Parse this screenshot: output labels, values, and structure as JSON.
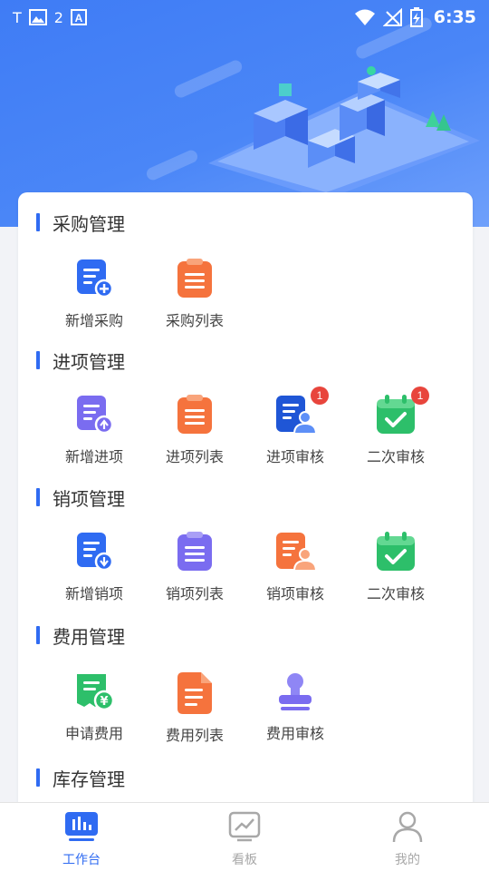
{
  "status_bar": {
    "time": "6:35",
    "left_text": "T",
    "left_num": "2",
    "icons": [
      "image-icon",
      "a-icon",
      "wifi-icon",
      "no-signal-icon",
      "battery-charging-icon"
    ]
  },
  "sections": [
    {
      "title": "采购管理",
      "items": [
        {
          "label": "新增采购",
          "icon": "doc-plus-icon",
          "badge": null
        },
        {
          "label": "采购列表",
          "icon": "clipboard-list-icon",
          "badge": null
        }
      ]
    },
    {
      "title": "进项管理",
      "items": [
        {
          "label": "新增进项",
          "icon": "doc-upload-icon",
          "badge": null
        },
        {
          "label": "进项列表",
          "icon": "clipboard-list-icon",
          "badge": null
        },
        {
          "label": "进项审核",
          "icon": "doc-user-icon",
          "badge": "1"
        },
        {
          "label": "二次审核",
          "icon": "calendar-check-icon",
          "badge": "1"
        }
      ]
    },
    {
      "title": "销项管理",
      "items": [
        {
          "label": "新增销项",
          "icon": "doc-download-icon",
          "badge": null
        },
        {
          "label": "销项列表",
          "icon": "clipboard-list-icon",
          "badge": null
        },
        {
          "label": "销项审核",
          "icon": "doc-user-icon",
          "badge": null
        },
        {
          "label": "二次审核",
          "icon": "calendar-check-icon",
          "badge": null
        }
      ]
    },
    {
      "title": "费用管理",
      "items": [
        {
          "label": "申请费用",
          "icon": "receipt-yen-icon",
          "badge": null
        },
        {
          "label": "费用列表",
          "icon": "file-list-icon",
          "badge": null
        },
        {
          "label": "费用审核",
          "icon": "stamp-icon",
          "badge": null
        }
      ]
    },
    {
      "title": "库存管理",
      "items": []
    }
  ],
  "tabs": [
    {
      "label": "工作台",
      "icon": "workbench-icon",
      "active": true
    },
    {
      "label": "看板",
      "icon": "dashboard-chart-icon",
      "active": false
    },
    {
      "label": "我的",
      "icon": "user-icon",
      "active": false
    }
  ],
  "colors": {
    "primary": "#2f6bf2",
    "orange": "#f5733d",
    "purple": "#7a6cf0",
    "green": "#2dbf6a",
    "badge": "#e8453c"
  }
}
